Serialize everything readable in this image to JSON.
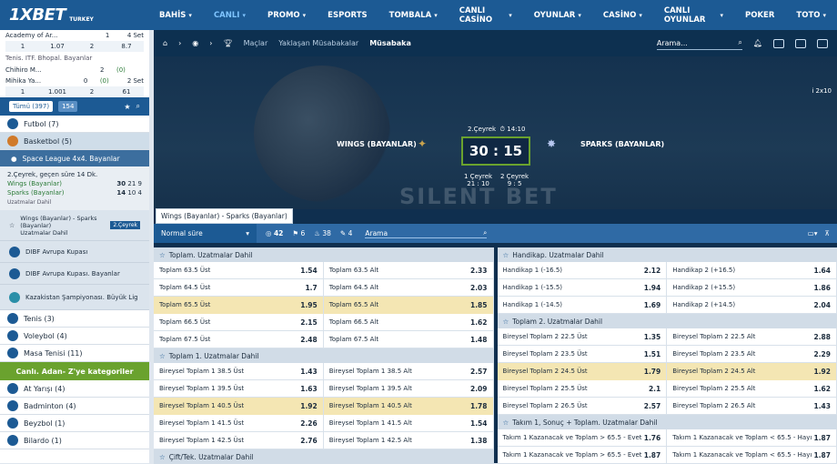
{
  "brand": {
    "logo": "1XBET",
    "region": "TURKEY"
  },
  "nav": {
    "items": [
      "BAHİS",
      "CANLI",
      "PROMO",
      "ESPORTS",
      "TOMBALA",
      "CANLI CASİNO",
      "OYUNLAR",
      "CASİNO",
      "CANLI OYUNLAR",
      "POKER",
      "TOTO"
    ]
  },
  "sidebar": {
    "live": [
      {
        "name": "Academy of Ar...",
        "score": "1",
        "set": "4 Set"
      },
      {
        "odds": [
          "1",
          "1.07",
          "2",
          "8.7"
        ]
      }
    ],
    "tennis_label": "Tenis. ITF. Bhopal. Bayanlar",
    "tennis": [
      {
        "name": "Chihiro M...",
        "score": "2",
        "set": "(0)"
      },
      {
        "name": "Mihika Ya...",
        "score": "0",
        "set": "(0)",
        "extra": "2 Set"
      }
    ],
    "tennis_odds": [
      "1",
      "1.001",
      "2",
      "61"
    ],
    "filters": {
      "all": "Tümü (397)",
      "live": "154"
    },
    "sports": [
      {
        "name": "Futbol (7)"
      },
      {
        "name": "Basketbol (5)"
      }
    ],
    "league": "Space League 4x4. Bayanlar",
    "match": {
      "time": "2.Çeyrek, geçen süre 14 Dk.",
      "team1": "Wings (Bayanlar)",
      "team2": "Sparks (Bayanlar)",
      "score1": "30",
      "score2": "14",
      "q1": "21",
      "q2": "10",
      "p1": "9",
      "p2": "4",
      "status": "Uzatmalar Dahil"
    },
    "sub_match": {
      "badge": "2.Çeyrek",
      "text": "Wings (Bayanlar) - Sparks (Bayanlar)",
      "extra": "Uzatmalar Dahil"
    },
    "leagues": [
      "DIBF Avrupa Kupası",
      "DIBF Avrupa Kupası. Bayanlar",
      "Kazakistan Şampiyonası. Büyük Lig"
    ],
    "sports2": [
      "Tenis (3)",
      "Voleybol (4)",
      "Masa Tenisi (11)"
    ],
    "cta": "Canlı. Adan- Z'ye kategoriler",
    "sports3": [
      "At Yarışı (4)",
      "Badminton (4)",
      "Beyzbol (1)",
      "Bilardo (1)"
    ]
  },
  "header": {
    "tabs": [
      "Maçlar",
      "Yaklaşan Müsabakalar",
      "Müsabaka"
    ],
    "search_placeholder": "Arama..."
  },
  "scoreboard": {
    "team1": "WINGS (BAYANLAR)",
    "team2": "SPARKS (BAYANLAR)",
    "period": "2.Çeyrek",
    "clock": "14:10",
    "score": "30 : 15",
    "q1_label": "1 Çeyrek",
    "q1": "21 : 10",
    "q2_label": "2 Çeyrek",
    "q2": "9 : 5",
    "watermark": "SILENT BET",
    "speed": "2x10"
  },
  "crumb": "Wings (Bayanlar) - Sparks (Bayanlar)",
  "filter": {
    "mode": "Normal süre",
    "count1": "42",
    "count2": "6",
    "count3": "38",
    "count4": "4",
    "search_placeholder": "Arama"
  },
  "markets_left": [
    {
      "title": "Toplam. Uzatmalar Dahil",
      "rows": [
        [
          "Toplam 63.5 Üst",
          "1.54",
          "Toplam 63.5 Alt",
          "2.33",
          false
        ],
        [
          "Toplam 64.5 Üst",
          "1.7",
          "Toplam 64.5 Alt",
          "2.03",
          false
        ],
        [
          "Toplam 65.5 Üst",
          "1.95",
          "Toplam 65.5 Alt",
          "1.85",
          true
        ],
        [
          "Toplam 66.5 Üst",
          "2.15",
          "Toplam 66.5 Alt",
          "1.62",
          false
        ],
        [
          "Toplam 67.5 Üst",
          "2.48",
          "Toplam 67.5 Alt",
          "1.48",
          false
        ]
      ]
    },
    {
      "title": "Toplam 1. Uzatmalar Dahil",
      "rows": [
        [
          "Bireysel Toplam 1 38.5 Üst",
          "1.43",
          "Bireysel Toplam 1 38.5 Alt",
          "2.57",
          false
        ],
        [
          "Bireysel Toplam 1 39.5 Üst",
          "1.63",
          "Bireysel Toplam 1 39.5 Alt",
          "2.09",
          false
        ],
        [
          "Bireysel Toplam 1 40.5 Üst",
          "1.92",
          "Bireysel Toplam 1 40.5 Alt",
          "1.78",
          true
        ],
        [
          "Bireysel Toplam 1 41.5 Üst",
          "2.26",
          "Bireysel Toplam 1 41.5 Alt",
          "1.54",
          false
        ],
        [
          "Bireysel Toplam 1 42.5 Üst",
          "2.76",
          "Bireysel Toplam 1 42.5 Alt",
          "1.38",
          false
        ]
      ]
    },
    {
      "title": "Çift/Tek. Uzatmalar Dahil",
      "rows": []
    }
  ],
  "markets_right": [
    {
      "title": "Handikap. Uzatmalar Dahil",
      "rows": [
        [
          "Handikap 1 (-16.5)",
          "2.12",
          "Handikap 2 (+16.5)",
          "1.64",
          false
        ],
        [
          "Handikap 1 (-15.5)",
          "1.94",
          "Handikap 2 (+15.5)",
          "1.86",
          false
        ],
        [
          "Handikap 1 (-14.5)",
          "1.69",
          "Handikap 2 (+14.5)",
          "2.04",
          false
        ]
      ]
    },
    {
      "title": "Toplam 2. Uzatmalar Dahil",
      "rows": [
        [
          "Bireysel Toplam 2 22.5 Üst",
          "1.35",
          "Bireysel Toplam 2 22.5 Alt",
          "2.88",
          false
        ],
        [
          "Bireysel Toplam 2 23.5 Üst",
          "1.51",
          "Bireysel Toplam 2 23.5 Alt",
          "2.29",
          false
        ],
        [
          "Bireysel Toplam 2 24.5 Üst",
          "1.79",
          "Bireysel Toplam 2 24.5 Alt",
          "1.92",
          true
        ],
        [
          "Bireysel Toplam 2 25.5 Üst",
          "2.1",
          "Bireysel Toplam 2 25.5 Alt",
          "1.62",
          false
        ],
        [
          "Bireysel Toplam 2 26.5 Üst",
          "2.57",
          "Bireysel Toplam 2 26.5 Alt",
          "1.43",
          false
        ]
      ]
    },
    {
      "title": "Takım 1, Sonuç + Toplam. Uzatmalar Dahil",
      "rows": [
        [
          "Takım 1 Kazanacak ve Toplam > 65.5 - Evet",
          "1.76",
          "Takım 1 Kazanacak ve Toplam < 65.5 - Hayı",
          "1.87",
          false
        ],
        [
          "Takım 1 Kazanacak ve Toplam > 65.5 - Evet",
          "1.87",
          "Takım 1 Kazanacak ve Toplam < 65.5 - Hayı",
          "1.87",
          false
        ]
      ]
    }
  ]
}
